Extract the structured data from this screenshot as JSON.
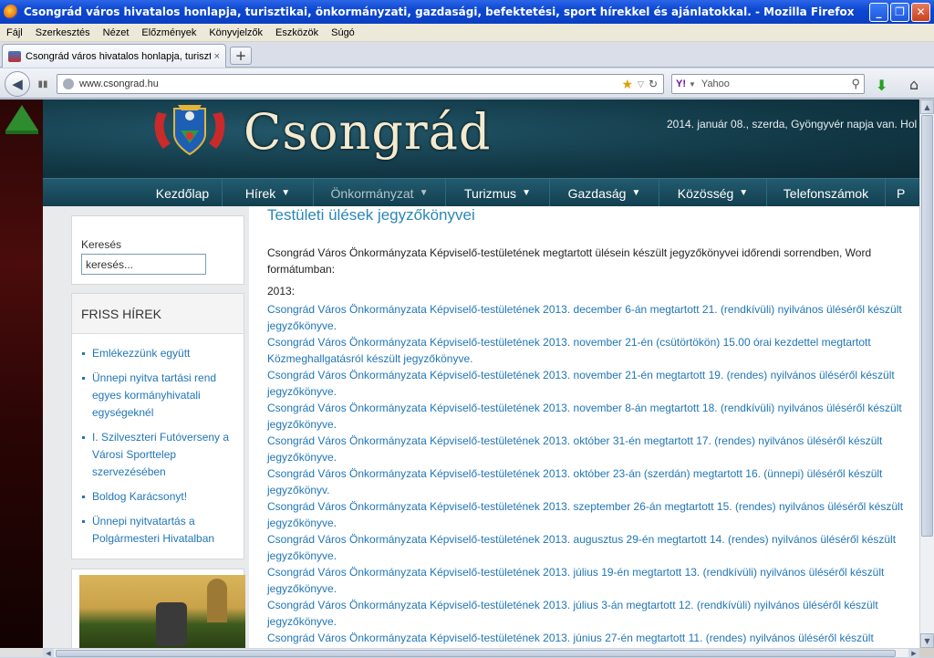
{
  "window": {
    "title": "Csongrád város hivatalos honlapja, turisztikai, önkormányzati, gazdasági, befektetési, sport hírekkel és ajánlatokkal. - Mozilla Firefox",
    "minimize": "_",
    "maximize": "❐",
    "close": "✕"
  },
  "menu": [
    "Fájl",
    "Szerkesztés",
    "Nézet",
    "Előzmények",
    "Könyvjelzők",
    "Eszközök",
    "Súgó"
  ],
  "tab": {
    "label": "Csongrád város hivatalos honlapja, turisztik...",
    "close": "×",
    "new": "+"
  },
  "nav": {
    "url": "www.csongrad.hu",
    "search_engine": "Y!",
    "search_placeholder": "Yahoo"
  },
  "site": {
    "brand": "Csongrád",
    "dateline": "2014. január 08., szerda, Gyöngyvér napja van. Hol",
    "nav_items": [
      {
        "label": "Kezdőlap",
        "caret": ""
      },
      {
        "label": "Hírek",
        "caret": "▼"
      },
      {
        "label": "Önkormányzat",
        "caret": "▼"
      },
      {
        "label": "Turizmus",
        "caret": "▼"
      },
      {
        "label": "Gazdaság",
        "caret": "▼"
      },
      {
        "label": "Közösség",
        "caret": "▼"
      },
      {
        "label": "Telefonszámok",
        "caret": ""
      },
      {
        "label": "P",
        "caret": ""
      }
    ]
  },
  "sidebar": {
    "search_label": "Keresés",
    "search_value": "keresés...",
    "news_heading": "FRISS HÍREK",
    "news": [
      "Emlékezzünk együtt",
      "Ünnepi nyitva tartási rend egyes kormányhivatali egységeknél",
      "I. Szilveszteri Futóverseny a Városi Sporttelep szervezésében",
      "Boldog Karácsonyt!",
      "Ünnepi nyitvatartás a Polgármesteri Hivatalban"
    ]
  },
  "content": {
    "title": "Testületi ülések jegyzőkönyvei",
    "intro": "Csongrád Város Önkormányzata Képviselő-testületének megtartott ülésein készült jegyzőkönyvei időrendi sorrendben, Word formátumban:",
    "year": "2013:",
    "links": [
      "Csongrád Város Önkormányzata Képviselő-testületének 2013. december 6-án megtartott 21. (rendkívüli) nyilvános üléséről készült jegyzőkönyve.",
      "Csongrád Város Önkormányzata Képviselő-testületének 2013. november 21-én (csütörtökön) 15.00 órai kezdettel megtartott Közmeghallgatásról készült jegyzőkönyve.",
      "Csongrád Város Önkormányzata Képviselő-testületének 2013. november 21-én megtartott 19. (rendes) nyilvános üléséről készült jegyzőkönyve.",
      "Csongrád Város Önkormányzata Képviselő-testületének 2013. november 8-án megtartott 18. (rendkívüli) nyilvános üléséről készült jegyzőkönyve.",
      "Csongrád Város Önkormányzata Képviselő-testületének 2013. október 31-én megtartott 17. (rendes) nyilvános üléséről készült jegyzőkönyve.",
      "Csongrád Város Önkormányzata Képviselő-testületének 2013. október 23-án (szerdán) megtartott 16. (ünnepi) üléséről készült jegyzőkönyv.",
      "Csongrád Város Önkormányzata Képviselő-testületének 2013. szeptember 26-án megtartott 15. (rendes) nyilvános üléséről készült jegyzőkönyve.",
      "Csongrád Város Önkormányzata Képviselő-testületének 2013. augusztus 29-én megtartott 14. (rendes) nyilvános üléséről készült jegyzőkönyve.",
      "Csongrád Város Önkormányzata Képviselő-testületének 2013. július 19-én megtartott 13. (rendkívüli) nyilvános üléséről készült jegyzőkönyve.",
      "Csongrád Város Önkormányzata Képviselő-testületének 2013. július 3-án megtartott 12. (rendkívüli) nyilvános üléséről készült jegyzőkönyve.",
      "Csongrád Város Önkormányzata Képviselő-testületének 2013. június 27-én megtartott 11. (rendes) nyilvános üléséről készült"
    ]
  },
  "colors": {
    "link": "#2176b6",
    "title": "#2b87b4",
    "header_bg": "#123845",
    "nav_bg": "#1b4c5e"
  }
}
